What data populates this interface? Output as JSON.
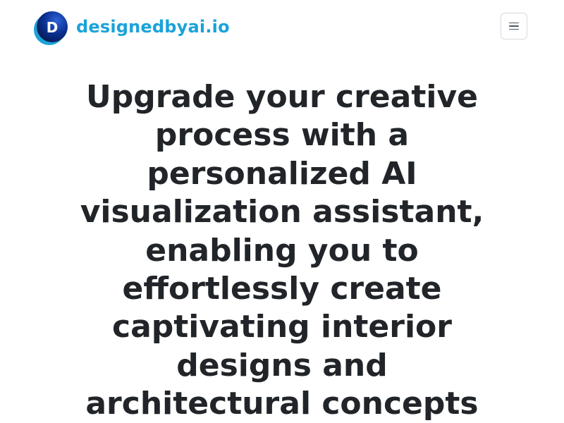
{
  "header": {
    "logo_letter": "D",
    "brand_name": "designedbyai.io",
    "menu_icon": "hamburger-icon"
  },
  "hero": {
    "title": "Upgrade your creative process with a personalized AI visualization assistant, enabling you to effortlessly create captivating interior designs and architectural concepts"
  },
  "colors": {
    "brand_text": "#1aa3d9",
    "logo_dark": "#0a2f8f",
    "heading": "#212529",
    "menu_border": "#d7dbe0"
  }
}
